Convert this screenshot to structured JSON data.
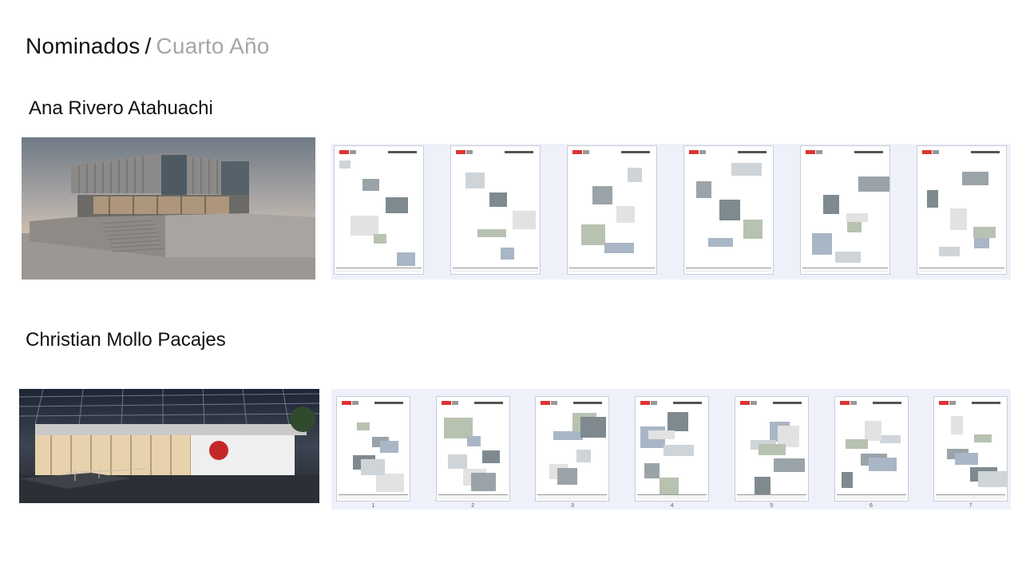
{
  "header": {
    "title": "Nominados",
    "separator": "/",
    "subtitle": "Cuarto Año"
  },
  "nominees": [
    {
      "name": "Ana Rivero Atahuachi",
      "hero_alt": "architecture-render-concrete-building",
      "sheets": [
        "",
        "",
        "",
        "",
        "",
        ""
      ]
    },
    {
      "name": "Christian Mollo Pacajes",
      "hero_alt": "architecture-render-night-pavilion",
      "sheets": [
        "1",
        "2",
        "3",
        "4",
        "5",
        "6",
        "7"
      ]
    }
  ],
  "colors": {
    "title": "#111111",
    "subtitle": "#a6a6a6",
    "strip_bg": "#eef1f9",
    "logo_red": "#dd3333"
  }
}
